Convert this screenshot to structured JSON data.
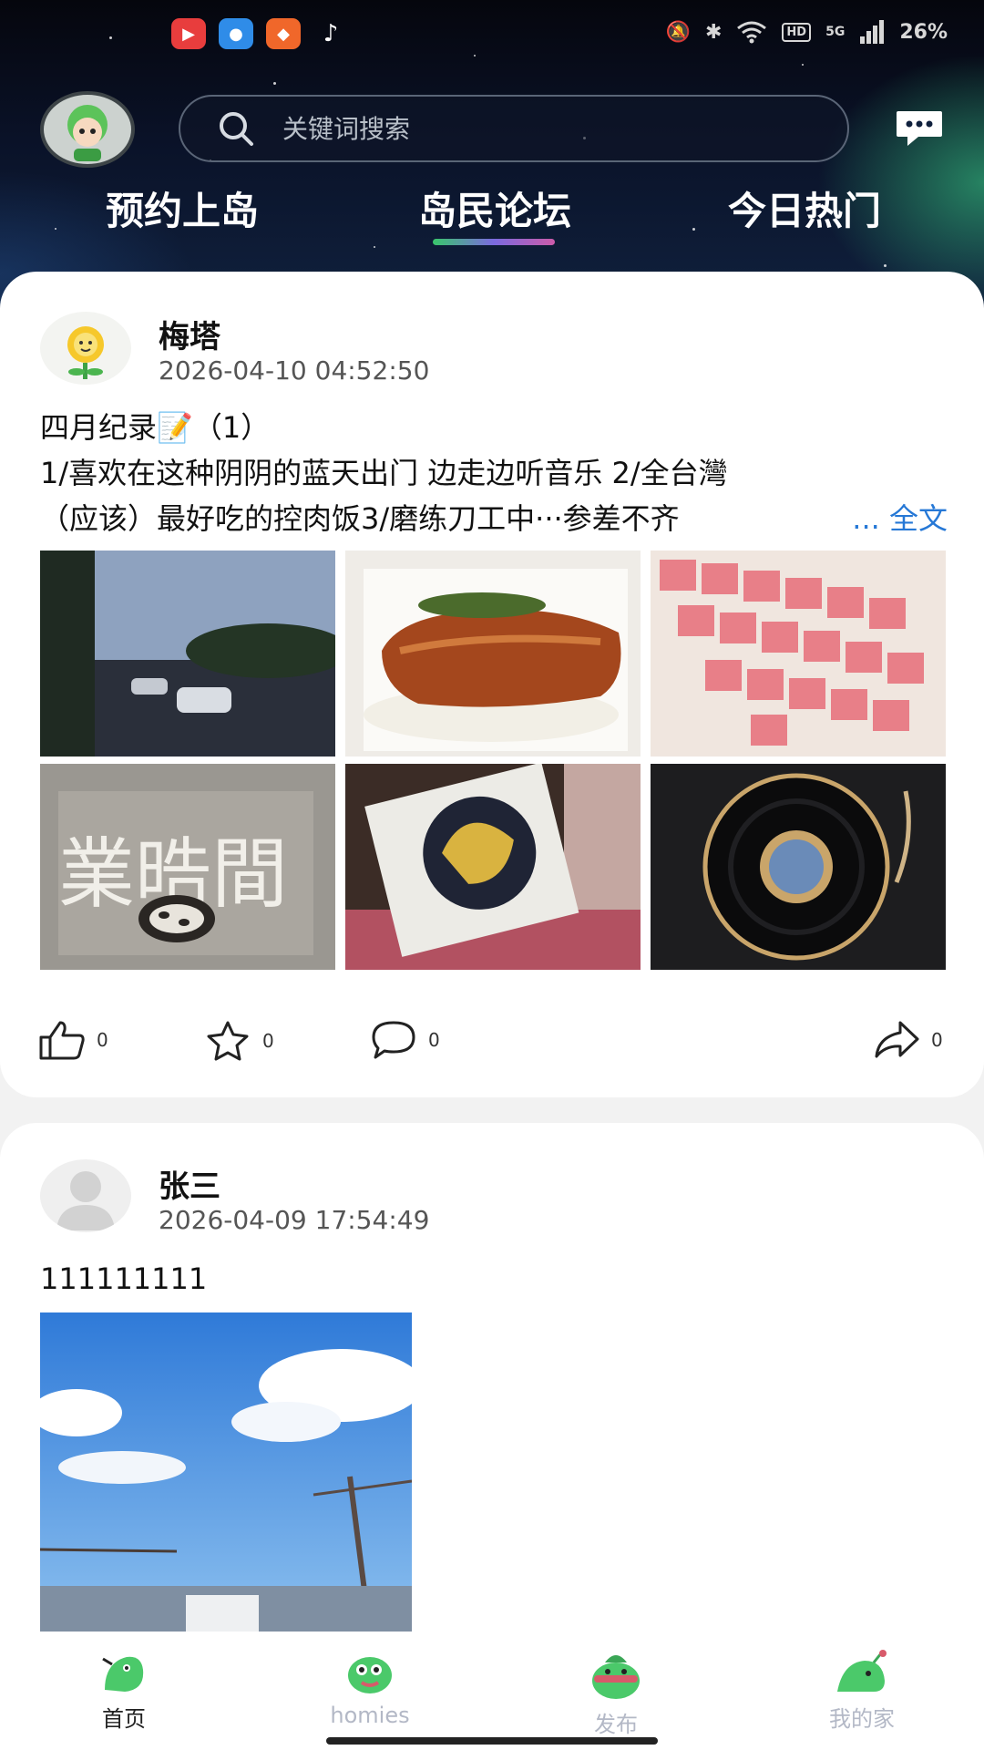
{
  "status_bar": {
    "battery": "26%",
    "hd_badge": "HD",
    "signal_label": "5G"
  },
  "search": {
    "placeholder": "关键词搜索"
  },
  "tabs": [
    {
      "label": "预约上岛",
      "active": false
    },
    {
      "label": "岛民论坛",
      "active": true
    },
    {
      "label": "今日热门",
      "active": false
    }
  ],
  "posts": [
    {
      "username": "梅塔",
      "time": "2026-04-10 04:52:50",
      "title": "四月纪录📝（1）",
      "line2": "1/喜欢在这种阴阴的蓝天出门 边走边听音乐 2/全台灣",
      "line3": "（应该）最好吃的控肉饭3/磨练刀工中···参差不齐",
      "more_label": "... 全文",
      "likes": "0",
      "favorites": "0",
      "comments": "0",
      "shares": "0",
      "image_overlay_text": "業晧間"
    },
    {
      "username": "张三",
      "time": "2026-04-09 17:54:49",
      "title": "111111111"
    }
  ],
  "bottom_nav": [
    {
      "label": "首页",
      "active": true
    },
    {
      "label": "homies",
      "active": false
    },
    {
      "label": "发布",
      "active": false
    },
    {
      "label": "我的家",
      "active": false
    }
  ],
  "colors": {
    "accent_link": "#2678d6",
    "nav_inactive": "#b3b8c6",
    "nav_active": "#222222"
  }
}
